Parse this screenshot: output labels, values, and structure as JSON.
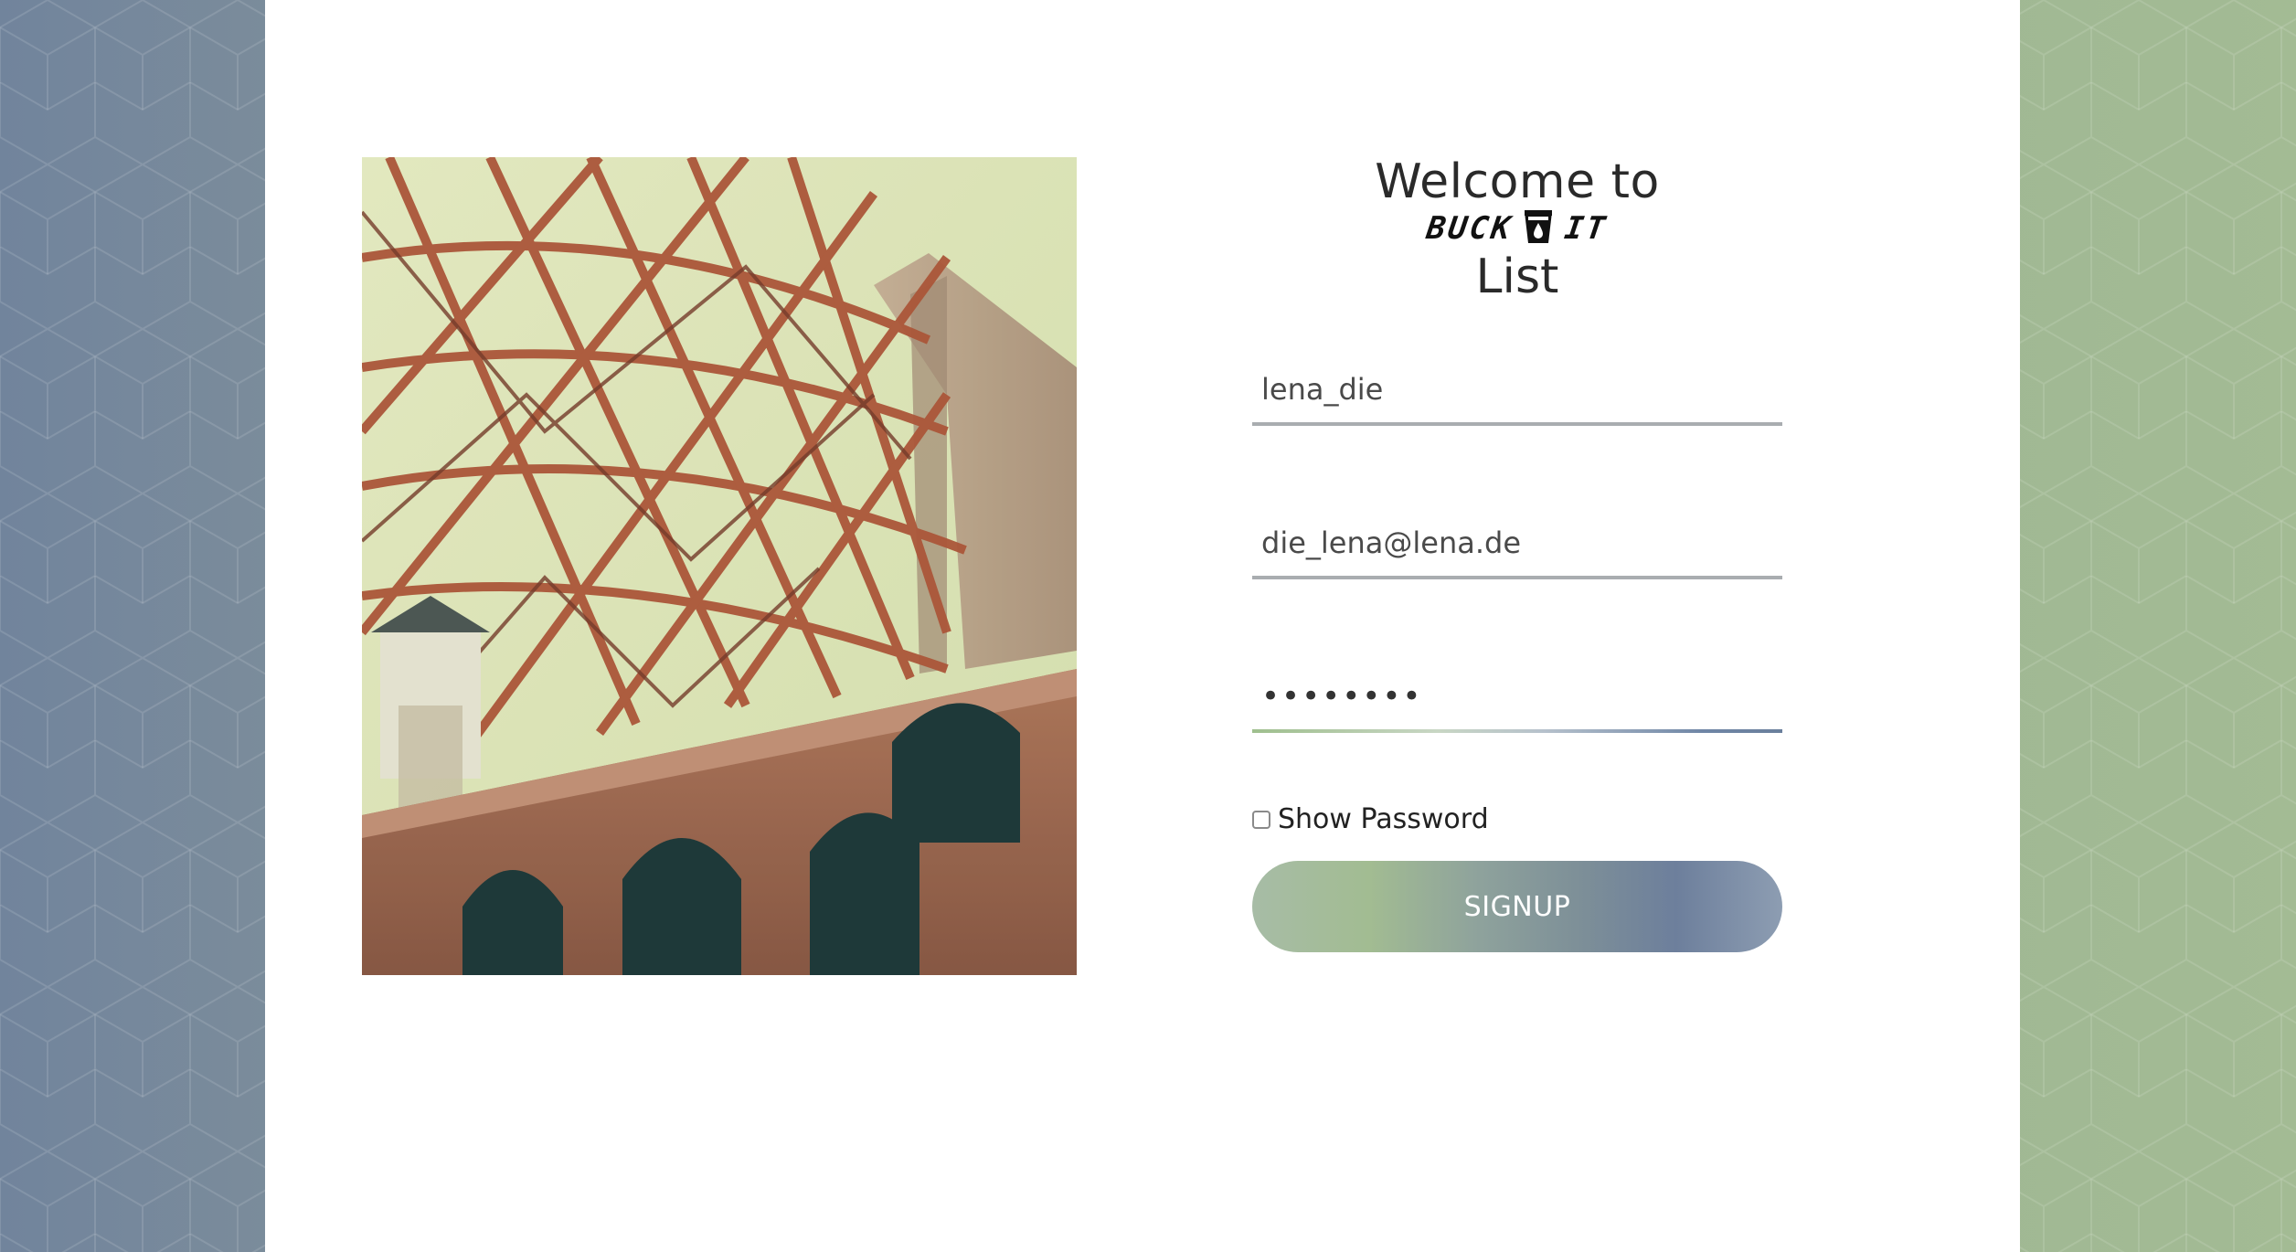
{
  "welcome": {
    "line1": "Welcome to",
    "logo_left": "BUCK",
    "logo_right": "IT",
    "line3": "List"
  },
  "form": {
    "username_value": "lena_die",
    "email_value": "die_lena@lena.de",
    "password_value": "••••••••",
    "show_password_label": "Show Password",
    "show_password_checked": false,
    "signup_label": "SIGNUP"
  },
  "colors": {
    "left_background": "#71849c",
    "right_background": "#a3bb94",
    "card": "#ffffff",
    "button_gradient_start": "#a7bca6",
    "button_gradient_end": "#6d7f9c"
  },
  "icons": {
    "logo_bucket": "bucket-icon",
    "photo": "bridge-photo"
  }
}
